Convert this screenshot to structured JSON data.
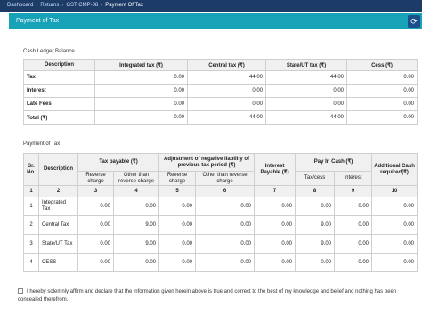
{
  "breadcrumb": [
    "Dashboard",
    "Returns",
    "GST CMP-08",
    "Payment Of Tax"
  ],
  "header": {
    "title": "Payment of Tax",
    "button_icon": "refresh-icon"
  },
  "cash_ledger": {
    "label": "Cash Ledger Balance",
    "columns": [
      "Description",
      "Integrated tax (₹)",
      "Central tax (₹)",
      "State/UT tax (₹)",
      "Cess (₹)"
    ],
    "rows": [
      {
        "desc": "Tax",
        "integrated": "0.00",
        "central": "44.00",
        "state": "44.00",
        "cess": "0.00"
      },
      {
        "desc": "Interest",
        "integrated": "0.00",
        "central": "0.00",
        "state": "0.00",
        "cess": "0.00"
      },
      {
        "desc": "Late Fees",
        "integrated": "0.00",
        "central": "0.00",
        "state": "0.00",
        "cess": "0.00"
      },
      {
        "desc": "Total (₹)",
        "integrated": "0.00",
        "central": "44.00",
        "state": "44.00",
        "cess": "0.00"
      }
    ]
  },
  "payment": {
    "label": "Payment of Tax",
    "headers": {
      "sr": "Sr. No.",
      "desc": "Description",
      "tax_payable": "Tax payable (₹)",
      "adjustment": "Adjustment of negative liability of previous tax period (₹)",
      "interest_payable": "Interest Payable (₹)",
      "pay_cash": "Pay In Cash (₹)",
      "additional_cash": "Additional Cash required(₹)",
      "reverse_charge": "Reverse charge",
      "other_reverse": "Other than reverse charge",
      "tax_cess": "Tax/cess",
      "interest": "Interest"
    },
    "col_numbers": [
      "1",
      "2",
      "3",
      "4",
      "5",
      "6",
      "7",
      "8",
      "9",
      "10"
    ],
    "rows": [
      {
        "sr": "1",
        "desc": "Integrated Tax",
        "tp_rc": "0.00",
        "tp_other": "0.00",
        "adj_rc": "0.00",
        "adj_other": "0.00",
        "interest_payable": "0.00",
        "tax_cess": "0.00",
        "interest": "0.00",
        "additional": "0.00"
      },
      {
        "sr": "2",
        "desc": "Central Tax",
        "tp_rc": "0.00",
        "tp_other": "9.00",
        "adj_rc": "0.00",
        "adj_other": "0.00",
        "interest_payable": "0.00",
        "tax_cess": "9.00",
        "interest": "0.00",
        "additional": "0.00"
      },
      {
        "sr": "3",
        "desc": "State/UT Tax",
        "tp_rc": "0.00",
        "tp_other": "9.00",
        "adj_rc": "0.00",
        "adj_other": "0.00",
        "interest_payable": "0.00",
        "tax_cess": "9.00",
        "interest": "0.00",
        "additional": "0.00"
      },
      {
        "sr": "4",
        "desc": "CESS",
        "tp_rc": "0.00",
        "tp_other": "0.00",
        "adj_rc": "0.00",
        "adj_other": "0.00",
        "interest_payable": "0.00",
        "tax_cess": "0.00",
        "interest": "0.00",
        "additional": "0.00"
      }
    ]
  },
  "declaration": "I hereby solemnly affirm and declare that the information given herein above is true and correct to the best of my knowledge and belief and nothing has been concealed therefrom."
}
